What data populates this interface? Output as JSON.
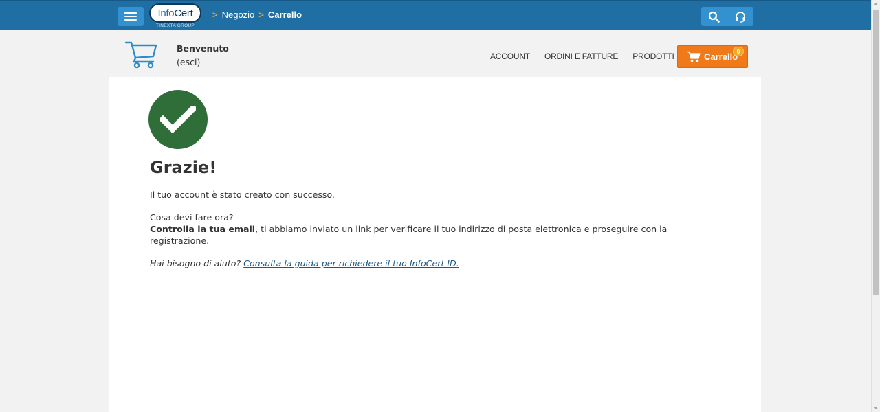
{
  "topbar": {
    "logo_main": "InfoCert",
    "logo_sub": "TINEXTA GROUP",
    "breadcrumb": [
      {
        "sep": ">",
        "label": "Negozio"
      },
      {
        "sep": ">",
        "label": "Carrello"
      }
    ],
    "icons": [
      "menu-icon",
      "search-icon",
      "headset-icon"
    ]
  },
  "header": {
    "welcome": "Benvenuto",
    "logout_open": "(",
    "logout": "esci",
    "logout_close": ")",
    "nav": [
      {
        "label": "ACCOUNT"
      },
      {
        "label": "ORDINI E FATTURE"
      },
      {
        "label": "PRODOTTI"
      }
    ],
    "cart_label": "Carrello",
    "cart_count": "0"
  },
  "main": {
    "title": "Grazie!",
    "line1": "Il tuo account è stato creato con successo.",
    "question": "Cosa devi fare ora?",
    "check_bold": "Controlla la tua email",
    "check_rest": ", ti abbiamo inviato un link per verificare il tuo indirizzo di posta elettronica e proseguire con la registrazione.",
    "help_text": "Hai bisogno di aiuto? ",
    "help_link": "Consulta la guida per richiedere il tuo InfoCert ID."
  },
  "colors": {
    "topbar": "#1f6fa5",
    "accent_orange": "#f07a1a",
    "success_green": "#2f6e38"
  }
}
